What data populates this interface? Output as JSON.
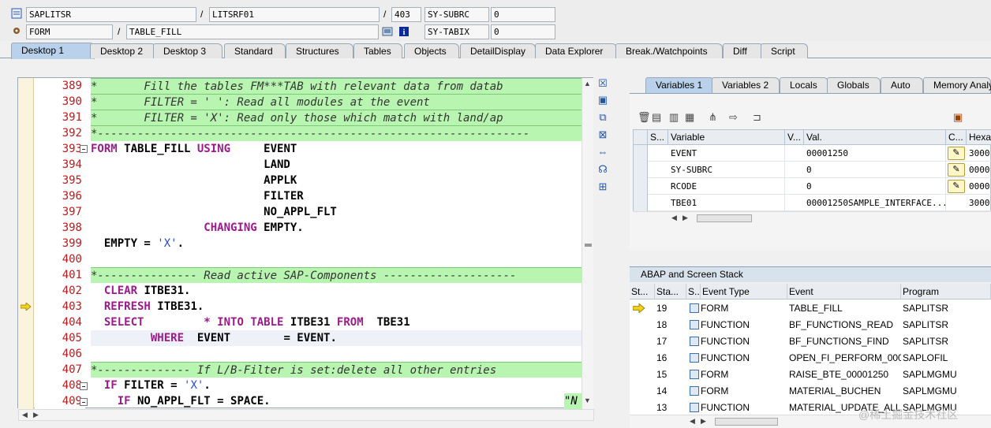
{
  "topbar": {
    "program": "SAPLITSR",
    "include": "LITSRF01",
    "line": "403",
    "field1_name": "SY-SUBRC",
    "field1_value": "0",
    "event_type": "FORM",
    "event_name": "TABLE_FILL",
    "field2_name": "SY-TABIX",
    "field2_value": "0"
  },
  "tabs": [
    "Desktop 1",
    "Desktop 2",
    "Desktop 3",
    "Standard",
    "Structures",
    "Tables",
    "Objects",
    "DetailDisplay",
    "Data Explorer",
    "Break./Watchpoints",
    "Diff",
    "Script"
  ],
  "editor": {
    "line_numbers": [
      "389",
      "390",
      "391",
      "392",
      "393",
      "394",
      "395",
      "396",
      "397",
      "398",
      "399",
      "400",
      "401",
      "402",
      "403",
      "404",
      "405",
      "406",
      "407",
      "408",
      "409"
    ],
    "lines": [
      {
        "kind": "comment",
        "text": "*       Fill the tables FM***TAB with relevant data from datab"
      },
      {
        "kind": "comment",
        "text": "*       FILTER = ' ': Read all modules at the event"
      },
      {
        "kind": "comment",
        "text": "*       FILTER = 'X': Read only those which match with land/ap"
      },
      {
        "kind": "comment",
        "text": "*-----------------------------------------------------------------"
      },
      {
        "kind": "code",
        "text": "FORM TABLE_FILL USING     EVENT"
      },
      {
        "kind": "code",
        "text": "                          LAND"
      },
      {
        "kind": "code",
        "text": "                          APPLK"
      },
      {
        "kind": "code",
        "text": "                          FILTER"
      },
      {
        "kind": "code",
        "text": "                          NO_APPL_FLT"
      },
      {
        "kind": "code",
        "text": "                 CHANGING EMPTY."
      },
      {
        "kind": "code",
        "text": "  EMPTY = 'X'."
      },
      {
        "kind": "code",
        "text": ""
      },
      {
        "kind": "comment",
        "text": "*--------------- Read active SAP-Components --------------------"
      },
      {
        "kind": "code",
        "text": "  CLEAR ITBE31."
      },
      {
        "kind": "code",
        "text": "  REFRESH ITBE31."
      },
      {
        "kind": "code",
        "text": "  SELECT         * INTO TABLE ITBE31 FROM  TBE31"
      },
      {
        "kind": "current",
        "text": "         WHERE  EVENT        = EVENT."
      },
      {
        "kind": "code",
        "text": ""
      },
      {
        "kind": "comment",
        "text": "*-------------- If L/B-Filter is set:delete all other entries"
      },
      {
        "kind": "code",
        "text": "  IF FILTER = 'X'."
      },
      {
        "kind": "code",
        "text": "    IF NO_APPL_FLT = SPACE."
      }
    ],
    "trailing_comment": "\"N"
  },
  "right_tabs": [
    "Variables 1",
    "Variables 2",
    "Locals",
    "Globals",
    "Auto",
    "Memory Analy"
  ],
  "variables": {
    "headers": [
      "S...",
      "Variable",
      "V...",
      "Val.",
      "C...",
      "Hexa"
    ],
    "rows": [
      {
        "variable": "EVENT",
        "value": "00001250",
        "hex": "3000"
      },
      {
        "variable": "SY-SUBRC",
        "value": "0",
        "hex": "0000"
      },
      {
        "variable": "RCODE",
        "value": "0",
        "hex": "0000"
      },
      {
        "variable": "TBE01",
        "value": "00001250SAMPLE_INTERFACE...",
        "hex": "3000"
      }
    ]
  },
  "stack": {
    "title": "ABAP and Screen Stack",
    "headers": [
      "St...",
      "Sta...",
      "S...",
      "Event Type",
      "Event",
      "Program"
    ],
    "rows": [
      {
        "level": "19",
        "type": "FORM",
        "event": "TABLE_FILL",
        "program": "SAPLITSR",
        "current": true
      },
      {
        "level": "18",
        "type": "FUNCTION",
        "event": "BF_FUNCTIONS_READ",
        "program": "SAPLITSR"
      },
      {
        "level": "17",
        "type": "FUNCTION",
        "event": "BF_FUNCTIONS_FIND",
        "program": "SAPLITSR"
      },
      {
        "level": "16",
        "type": "FUNCTION",
        "event": "OPEN_FI_PERFORM_000...",
        "program": "SAPLOFIL"
      },
      {
        "level": "15",
        "type": "FORM",
        "event": "RAISE_BTE_00001250",
        "program": "SAPLMGMU"
      },
      {
        "level": "14",
        "type": "FORM",
        "event": "MATERIAL_BUCHEN",
        "program": "SAPLMGMU"
      },
      {
        "level": "13",
        "type": "FUNCTION",
        "event": "MATERIAL_UPDATE_ALL",
        "program": "SAPLMGMU"
      }
    ]
  },
  "watermark": "@稀土掘金技术社区",
  "colors": {
    "accent_tab": "#b9d1ea",
    "comment_bg": "#b8f5b0",
    "keyword": "#9b1b8a",
    "line_no": "#c01818"
  }
}
